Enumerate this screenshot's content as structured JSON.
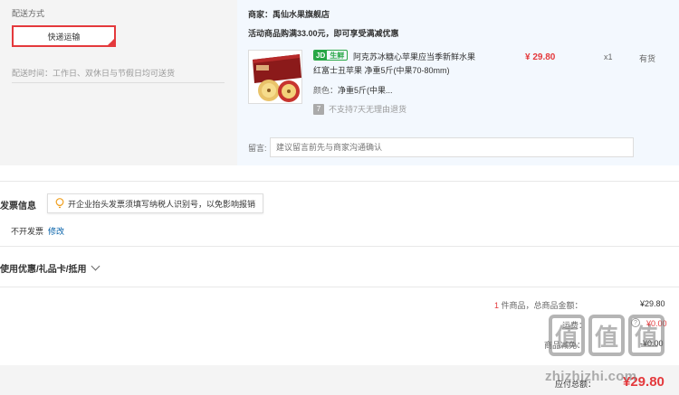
{
  "shipping": {
    "title": "配送方式",
    "method": "快递运输",
    "time": "配送时间：工作日、双休日与节假日均可送货"
  },
  "order": {
    "seller": "商家：禹仙水果旗舰店",
    "promo": "活动商品购满33.00元，即可享受满减优惠",
    "tag_icon": "JD",
    "tag_text": "生鲜",
    "name_line1": "阿克苏冰糖心苹果应当季新鲜水果",
    "name_line2": "红富士丑苹果 净重5斤(中果70-80mm)",
    "color_label": "颜色：",
    "color_value": "净重5斤(中果...",
    "return_icon": "7",
    "return_policy": "不支持7天无理由退货",
    "price": "¥ 29.80",
    "qty": "x1",
    "stock": "有货",
    "message_label": "留言:",
    "message_placeholder": "建议留言前先与商家沟通确认"
  },
  "invoice": {
    "title": "发票信息",
    "tip": "开企业抬头发票须填写纳税人识别号，以免影响报销",
    "value": "不开发票",
    "edit": "修改"
  },
  "coupon": {
    "label": "使用优惠/礼品卡/抵用"
  },
  "summary": {
    "count": "1",
    "count_suffix": " 件商品，总商品金额：",
    "goods_total": "¥29.80",
    "freight_label": "运费：",
    "freight_help": "?",
    "freight": "¥0.00",
    "discount_label": "商品减免：",
    "discount": "-¥0.00",
    "pay_label": "应付总额：",
    "pay_total": "¥29.80"
  },
  "watermark": {
    "glyph": "值",
    "site": "zhizhizhi.com"
  },
  "colors": {
    "accent": "#e4393c",
    "link": "#005ea7",
    "fresh": "#28a745"
  }
}
